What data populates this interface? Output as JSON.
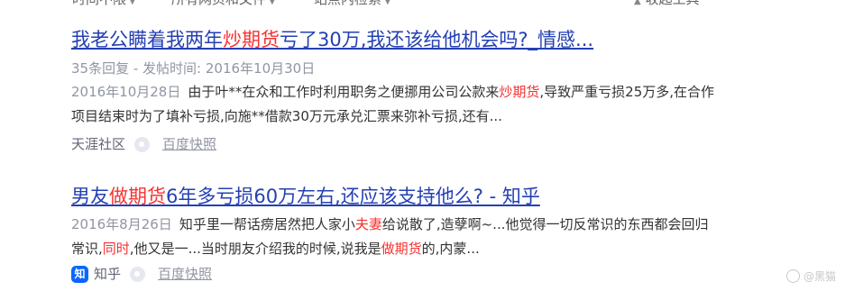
{
  "toolbar": {
    "time_filter": "时间不限",
    "type_filter": "所有网页和文件",
    "site_filter": "站点内检索",
    "collapse_tools": "收起工具"
  },
  "results": [
    {
      "title_pre": "我老公瞒着我两年",
      "title_hl": "炒期货",
      "title_post": "亏了30万,我还该给他机会吗?_情感...",
      "meta": "35条回复 - 发帖时间: 2016年10月30日",
      "abstract_date": "2016年10月28日",
      "abstract_1": "由于叶**在众和工作时利用职务之便挪用公司公款来",
      "abstract_hl_1": "炒期货",
      "abstract_2": ",导致严重亏损25万多,在合作项目结束时为了填补亏损,向施**借款30万元承兑汇票来弥补亏损,还有...",
      "source": "天涯社区",
      "snapshot": "百度快照"
    },
    {
      "title_pre": "男友",
      "title_hl": "做期货",
      "title_post": "6年多亏损60万左右,还应该支持他么? - 知乎",
      "abstract_date": "2016年8月26日",
      "abstract_1": "知乎里一帮话痨居然把人家小",
      "abstract_hl_1": "夫妻",
      "abstract_2": "给说散了,造孽啊~...他觉得一切反常识的东西都会回归常识,",
      "abstract_hl_2": "同时",
      "abstract_3": ",他又是一...当时朋友介绍我的时候,说我是",
      "abstract_hl_3": "做期货",
      "abstract_4": "的,内蒙...",
      "source_icon": "知",
      "source": "知乎",
      "snapshot": "百度快照"
    }
  ],
  "watermark": "@黑猫"
}
